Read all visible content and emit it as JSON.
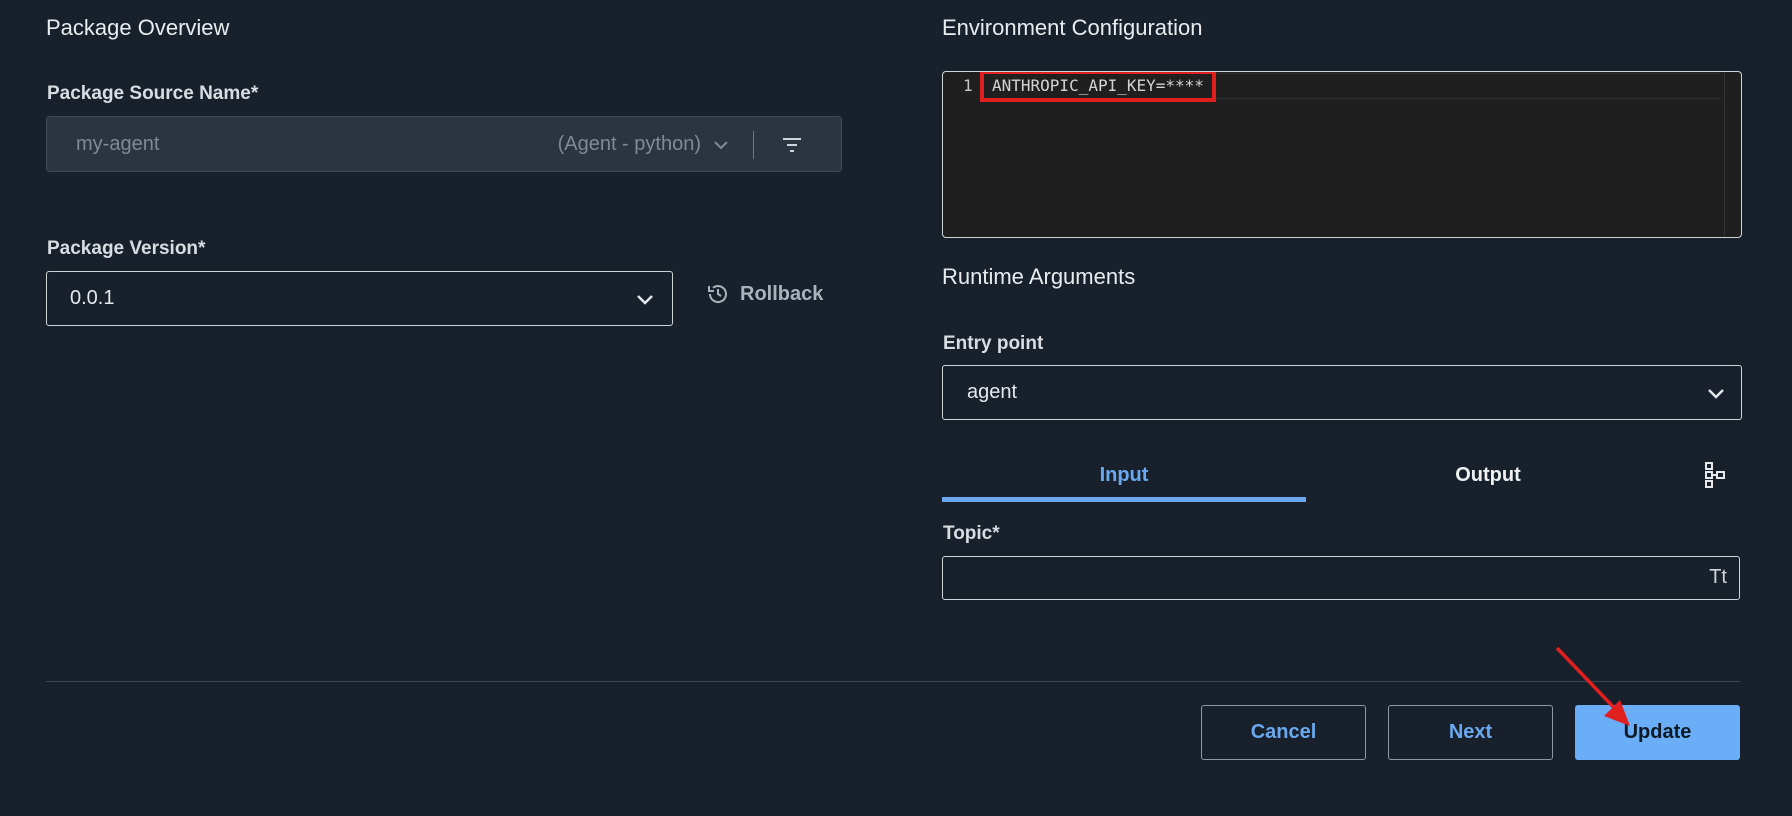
{
  "package_overview": {
    "title": "Package Overview",
    "source_label": "Package Source Name*",
    "source_name": "my-agent",
    "source_type": "(Agent - python)",
    "version_label": "Package Version*",
    "version_value": "0.0.1",
    "rollback_label": "Rollback"
  },
  "environment": {
    "title": "Environment Configuration",
    "lines": [
      {
        "number": "1",
        "text": "ANTHROPIC_API_KEY=****"
      }
    ]
  },
  "runtime": {
    "title": "Runtime Arguments",
    "entry_label": "Entry point",
    "entry_value": "agent",
    "tabs": [
      {
        "label": "Input",
        "active": true
      },
      {
        "label": "Output",
        "active": false
      }
    ],
    "topic_label": "Topic*",
    "topic_value": "",
    "topic_type_icon": "Tt"
  },
  "footer": {
    "cancel_label": "Cancel",
    "next_label": "Next",
    "update_label": "Update"
  },
  "colors": {
    "background": "#18212b",
    "accent": "#6aa9ef",
    "primary_button": "#6aaef7",
    "annotation": "#e01f1f"
  },
  "icons": {
    "source_dropdown": "chevron-down-icon",
    "filter": "filter-icon",
    "version_dropdown": "chevron-down-icon",
    "rollback": "history-icon",
    "entry_dropdown": "chevron-down-icon",
    "schema": "tree-structure-icon",
    "text_type": "text-type-icon"
  }
}
